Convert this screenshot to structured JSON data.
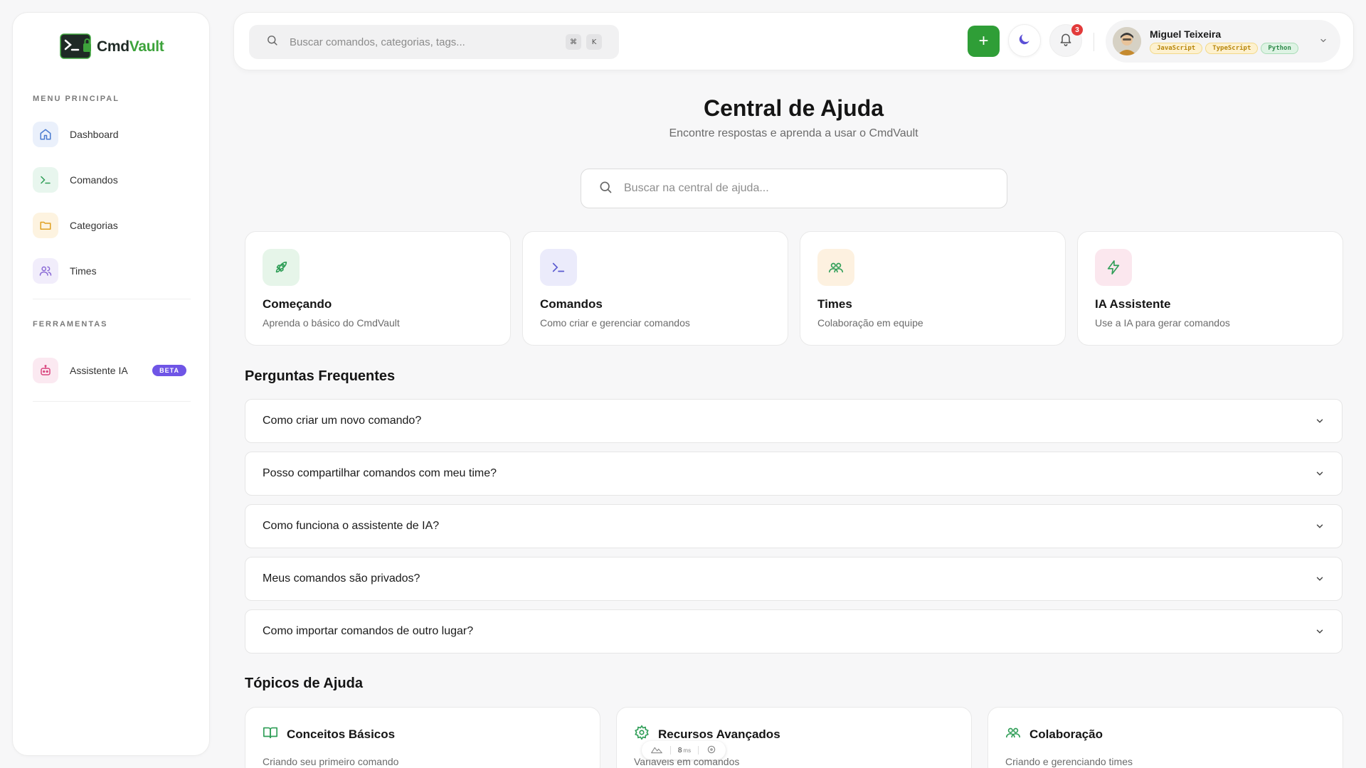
{
  "app": {
    "logo_part1": "Cmd",
    "logo_part2": "Vault"
  },
  "sidebar": {
    "menu_title": "MENU PRINCIPAL",
    "items": [
      {
        "label": "Dashboard",
        "icon": "home-icon"
      },
      {
        "label": "Comandos",
        "icon": "terminal-icon"
      },
      {
        "label": "Categorias",
        "icon": "folder-icon"
      },
      {
        "label": "Times",
        "icon": "users-icon"
      }
    ],
    "tools_title": "FERRAMENTAS",
    "tools": [
      {
        "label": "Assistente IA",
        "icon": "bot-icon",
        "badge": "BETA"
      }
    ]
  },
  "topbar": {
    "search_placeholder": "Buscar comandos, categorias, tags...",
    "kbd1": "⌘",
    "kbd2": "K",
    "add_label": "+",
    "notif_count": "3",
    "user": {
      "name": "Miguel Teixeira",
      "tags": [
        {
          "label": "JavaScript",
          "bg": "#fdf1cf",
          "fg": "#b8860b",
          "border": "#f2d98a"
        },
        {
          "label": "TypeScript",
          "bg": "#fdf1cf",
          "fg": "#b8860b",
          "border": "#f2d98a"
        },
        {
          "label": "Python",
          "bg": "#def3e4",
          "fg": "#2f8a4a",
          "border": "#a9dcb7"
        }
      ]
    }
  },
  "main": {
    "title": "Central de Ajuda",
    "subtitle": "Encontre respostas e aprenda a usar o CmdVault",
    "search_placeholder": "Buscar na central de ajuda...",
    "categories": [
      {
        "title": "Começando",
        "desc": "Aprenda o básico do CmdVault",
        "icon": "rocket-icon"
      },
      {
        "title": "Comandos",
        "desc": "Como criar e gerenciar comandos",
        "icon": "terminal-icon"
      },
      {
        "title": "Times",
        "desc": "Colaboração em equipe",
        "icon": "users-icon"
      },
      {
        "title": "IA Assistente",
        "desc": "Use a IA para gerar comandos",
        "icon": "lightning-icon"
      }
    ],
    "faq_title": "Perguntas Frequentes",
    "faqs": [
      "Como criar um novo comando?",
      "Posso compartilhar comandos com meu time?",
      "Como funciona o assistente de IA?",
      "Meus comandos são privados?",
      "Como importar comandos de outro lugar?"
    ],
    "topics_title": "Tópicos de Ajuda",
    "topics": [
      {
        "title": "Conceitos Básicos",
        "first_link": "Criando seu primeiro comando",
        "icon": "book-icon"
      },
      {
        "title": "Recursos Avançados",
        "first_link": "Variáveis em comandos",
        "icon": "gear-icon"
      },
      {
        "title": "Colaboração",
        "first_link": "Criando e gerenciando times",
        "icon": "users-icon"
      }
    ]
  },
  "dev_overlay": {
    "value": "8",
    "unit": "ms"
  },
  "colors": {
    "accent_green": "#2f9e37",
    "beta_purple": "#6f55e6",
    "badge_red": "#e23a3a"
  }
}
